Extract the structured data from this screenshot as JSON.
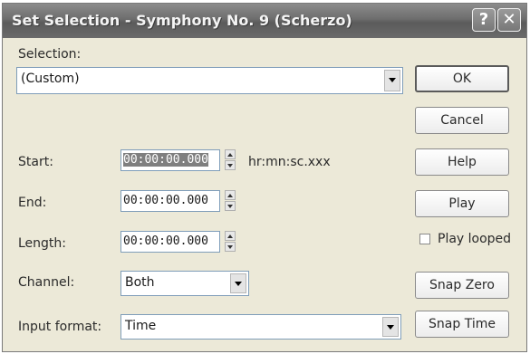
{
  "dialog": {
    "title": "Set Selection - Symphony No. 9 (Scherzo)",
    "help_glyph": "?",
    "close_glyph": "✕"
  },
  "selection": {
    "label": "Selection:",
    "value": "(Custom)"
  },
  "start": {
    "label": "Start:",
    "value": "00:00:00.000",
    "format_hint": "hr:mn:sc.xxx"
  },
  "end": {
    "label": "End:",
    "value": "00:00:00.000"
  },
  "length": {
    "label": "Length:",
    "value": "00:00:00.000"
  },
  "channel": {
    "label": "Channel:",
    "value": "Both"
  },
  "input_format": {
    "label": "Input format:",
    "value": "Time"
  },
  "buttons": {
    "ok": "OK",
    "cancel": "Cancel",
    "help": "Help",
    "play": "Play",
    "play_looped": "Play looped",
    "snap_zero": "Snap Zero",
    "snap_time": "Snap Time"
  },
  "colors": {
    "titlebar": "#6d6d6d",
    "dialog_bg": "#ece9d8",
    "selected_text_bg": "#7f7f7f"
  }
}
